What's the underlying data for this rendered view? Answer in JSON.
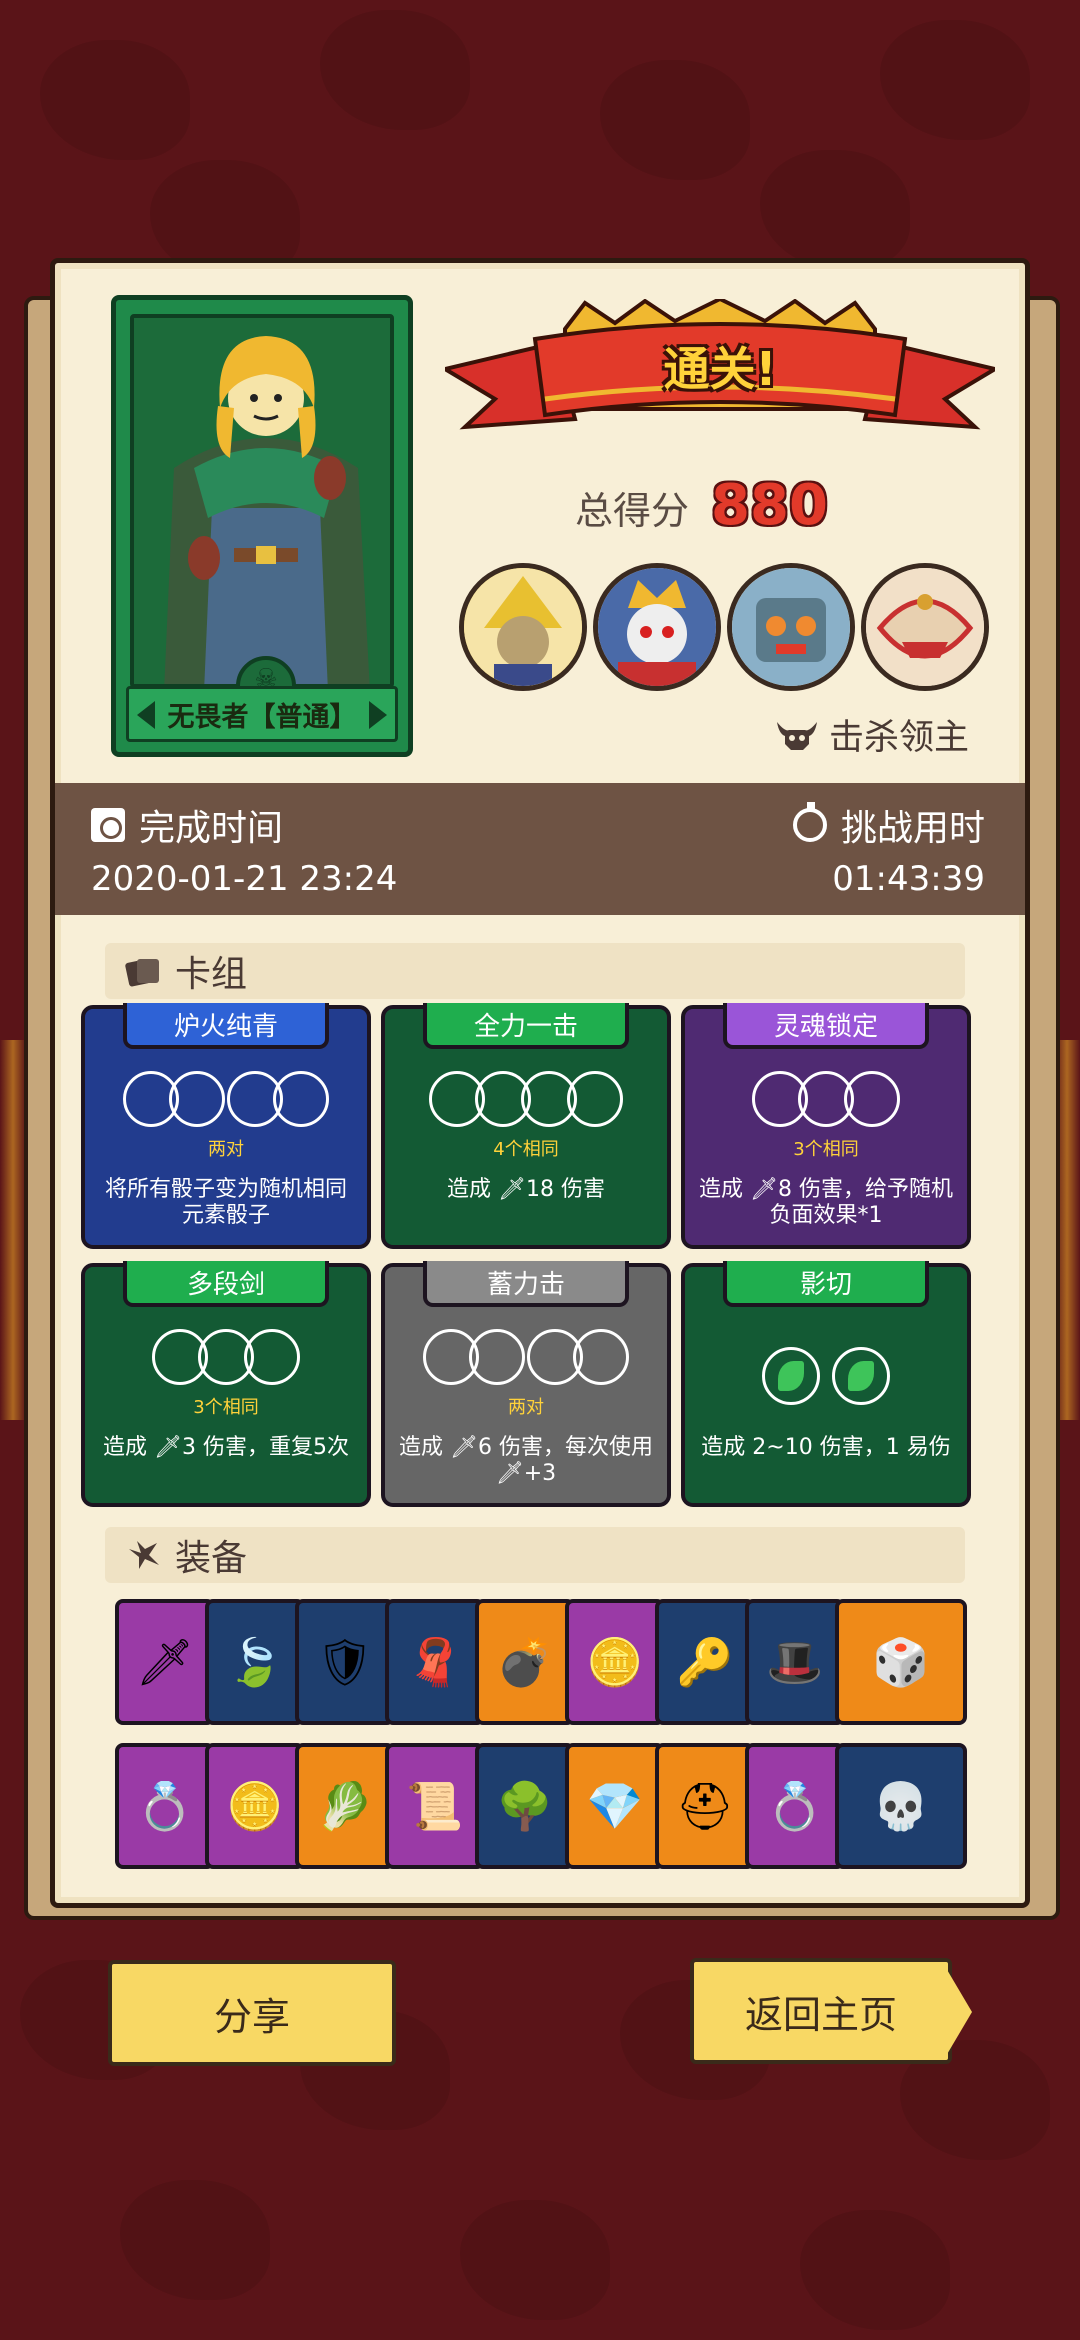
{
  "banner": {
    "title": "通关!"
  },
  "score": {
    "label": "总得分",
    "value": "880"
  },
  "character": {
    "name": "无畏者【普通】"
  },
  "bosses": {
    "label": "击杀领主",
    "portraits": [
      "boss-icon-1",
      "boss-icon-2",
      "boss-icon-3",
      "boss-icon-4"
    ]
  },
  "time": {
    "finish_label": "完成时间",
    "finish_value": "2020-01-21 23:24",
    "duration_label": "挑战用时",
    "duration_value": "01:43:39"
  },
  "deck": {
    "title": "卡组",
    "cards": [
      {
        "name": "炉火纯青",
        "condition": "两对",
        "effect": "将所有骰子变为随机相同元素骰子",
        "color": "blue"
      },
      {
        "name": "全力一击",
        "condition": "4个相同",
        "effect": "造成 🗡18 伤害",
        "color": "green"
      },
      {
        "name": "灵魂锁定",
        "condition": "3个相同",
        "effect": "造成 🗡8 伤害，给予随机负面效果*1",
        "color": "purple"
      },
      {
        "name": "多段剑",
        "condition": "3个相同",
        "effect": "造成 🗡3 伤害，重复5次",
        "color": "green"
      },
      {
        "name": "蓄力击",
        "condition": "两对",
        "effect": "造成 🗡6 伤害，每次使用 🗡+3",
        "color": "grey"
      },
      {
        "name": "影切",
        "condition": "",
        "effect": "造成 2~10 伤害，1 易伤",
        "color": "green"
      }
    ]
  },
  "equipment": {
    "title": "装备",
    "row1": [
      "dagger-icon",
      "leaves-icon",
      "gem-shield-icon",
      "torn-cloth-icon",
      "cannon-icon",
      "gold-coin-icon",
      "key-icon",
      "top-hat-icon",
      "green-die-icon"
    ],
    "row2": [
      "ring-icon",
      "gold-coin-icon",
      "green-stone-icon",
      "fire-scroll-icon",
      "bush-creature-icon",
      "crystal-icon",
      "helmet-icon",
      "gem-ring-icon",
      "skull-rocket-icon"
    ]
  },
  "buttons": {
    "share": "分享",
    "home": "返回主页"
  },
  "colors": {
    "background": "#5a1418",
    "panel": "#f8efd7",
    "accent_red": "#e23a2a",
    "gold": "#ffd23a"
  }
}
